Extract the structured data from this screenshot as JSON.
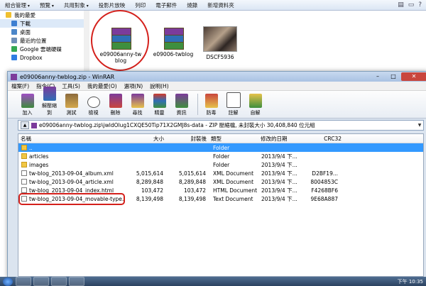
{
  "explorer": {
    "toolbar": [
      "組合管理",
      "預覽",
      "共用對象",
      "投影片放映",
      "列印",
      "電子郵件",
      "燒錄",
      "新增資料夾"
    ],
    "nav": [
      {
        "label": "我的最愛",
        "icon": "star-icon",
        "color": "#f0c030"
      },
      {
        "label": "下載",
        "icon": "download-folder-icon",
        "color": "#3d7fd1"
      },
      {
        "label": "桌面",
        "icon": "desktop-icon",
        "color": "#4b86c9"
      },
      {
        "label": "最近的位置",
        "icon": "recent-places-icon",
        "color": "#6e8fb8"
      },
      {
        "label": "Google 雲端硬碟",
        "icon": "google-drive-icon",
        "color": "#34a853"
      },
      {
        "label": "Dropbox",
        "icon": "dropbox-icon",
        "color": "#2f7de1"
      }
    ],
    "files": [
      {
        "name": "e09006anny-tw\nblog",
        "icon": "rar-archive-icon"
      },
      {
        "name": "e09006-twblog",
        "icon": "rar-archive-icon"
      },
      {
        "name": "DSCF5936",
        "icon": "photo-thumbnail-icon"
      }
    ]
  },
  "winrar": {
    "title": "e09006anny-twblog.zip - WinRAR",
    "menu": [
      "檔案(F)",
      "指令(C)",
      "工具(S)",
      "我的最愛(O)",
      "選項(N)",
      "說明(H)"
    ],
    "tools": [
      "加入",
      "解壓縮到",
      "測試",
      "檢視",
      "刪除",
      "尋找",
      "精靈",
      "資訊",
      "防毒",
      "註解",
      "自解"
    ],
    "path": "e09006anny-twblog.zip\\jwldOlug1CXQE50Tip71X2GMJ8s-data - ZIP 壓縮檔, 未封裝大小 30,408,840 位元組",
    "columns": [
      "名稱",
      "大小",
      "封裝後",
      "類型",
      "修改的日期",
      "CRC32"
    ],
    "rows": [
      {
        "name": "..",
        "size": "",
        "packed": "",
        "type": "Folder",
        "modified": "",
        "crc": "",
        "kind": "folder",
        "selected": true
      },
      {
        "name": "articles",
        "size": "",
        "packed": "",
        "type": "Folder",
        "modified": "2013/9/4 下...",
        "crc": "",
        "kind": "folder",
        "selected": false
      },
      {
        "name": "images",
        "size": "",
        "packed": "",
        "type": "Folder",
        "modified": "2013/9/4 下...",
        "crc": "",
        "kind": "folder",
        "selected": false
      },
      {
        "name": "tw-blog_2013-09-04_album.xml",
        "size": "5,015,614",
        "packed": "5,015,614",
        "type": "XML Document",
        "modified": "2013/9/4 下...",
        "crc": "D2BF19...",
        "kind": "doc",
        "selected": false
      },
      {
        "name": "tw-blog_2013-09-04_article.xml",
        "size": "8,289,848",
        "packed": "8,289,848",
        "type": "XML Document",
        "modified": "2013/9/4 下...",
        "crc": "8004853C",
        "kind": "doc",
        "selected": false
      },
      {
        "name": "tw-blog_2013-09-04_index.html",
        "size": "103,472",
        "packed": "103,472",
        "type": "HTML Document",
        "modified": "2013/9/4 下...",
        "crc": "F4268BF6",
        "kind": "doc",
        "selected": false
      },
      {
        "name": "tw-blog_2013-09-04_movable-type.txt",
        "size": "8,139,498",
        "packed": "8,139,498",
        "type": "Text Document",
        "modified": "2013/9/4 下...",
        "crc": "9E68A887",
        "kind": "doc",
        "selected": false
      }
    ]
  },
  "taskbar": {
    "clock": "下午 10:35"
  }
}
